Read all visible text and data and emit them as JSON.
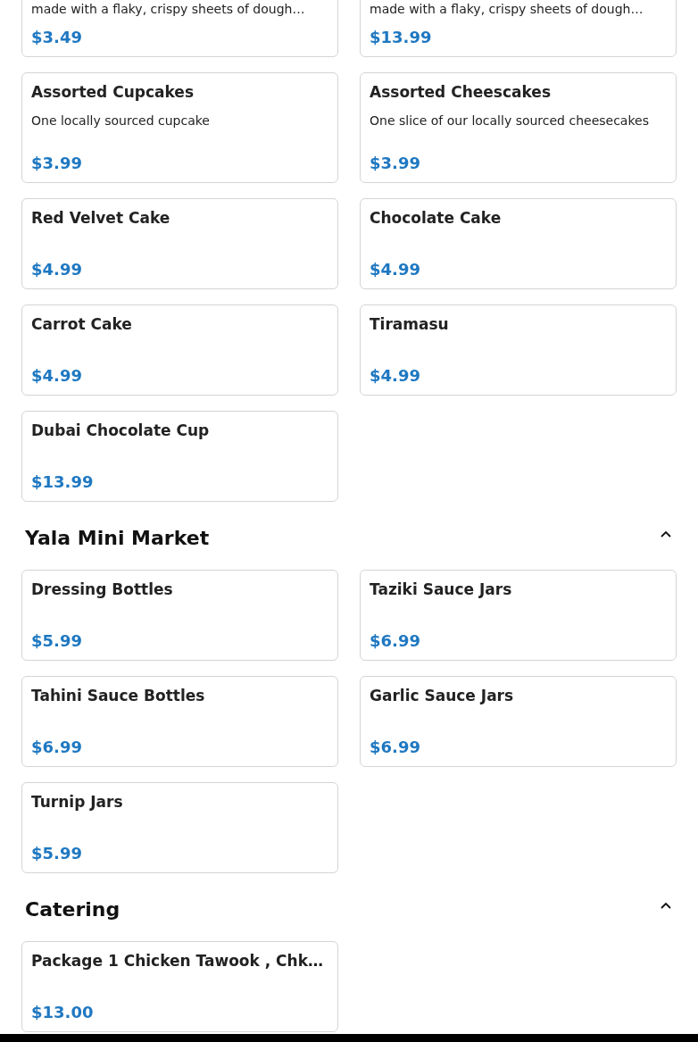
{
  "sections": [
    {
      "items": [
        {
          "description": "made with a flaky, crispy sheets of dough…",
          "price": "$3.49"
        },
        {
          "description": "made with a flaky, crispy sheets of dough…",
          "price": "$13.99"
        },
        {
          "name": "Assorted Cupcakes",
          "description": "One locally sourced cupcake",
          "price": "$3.99"
        },
        {
          "name": "Assorted Cheescakes",
          "description": "One slice of our locally sourced cheesecakes",
          "price": "$3.99"
        },
        {
          "name": "Red Velvet Cake",
          "price": "$4.99"
        },
        {
          "name": "Chocolate Cake",
          "price": "$4.99"
        },
        {
          "name": "Carrot Cake",
          "price": "$4.99"
        },
        {
          "name": "Tiramasu",
          "price": "$4.99"
        },
        {
          "name": "Dubai Chocolate Cup",
          "price": "$13.99"
        }
      ]
    },
    {
      "title": "Yala Mini Market",
      "expanded": true,
      "items": [
        {
          "name": "Dressing Bottles",
          "price": "$5.99"
        },
        {
          "name": "Taziki Sauce Jars",
          "price": "$6.99"
        },
        {
          "name": "Tahini Sauce Bottles",
          "price": "$6.99"
        },
        {
          "name": "Garlic Sauce Jars",
          "price": "$6.99"
        },
        {
          "name": "Turnip Jars",
          "price": "$5.99"
        }
      ]
    },
    {
      "title": "Catering",
      "expanded": true,
      "items": [
        {
          "name": "Package 1 Chicken Tawook , Chk…",
          "price": "$13.00"
        }
      ]
    }
  ]
}
